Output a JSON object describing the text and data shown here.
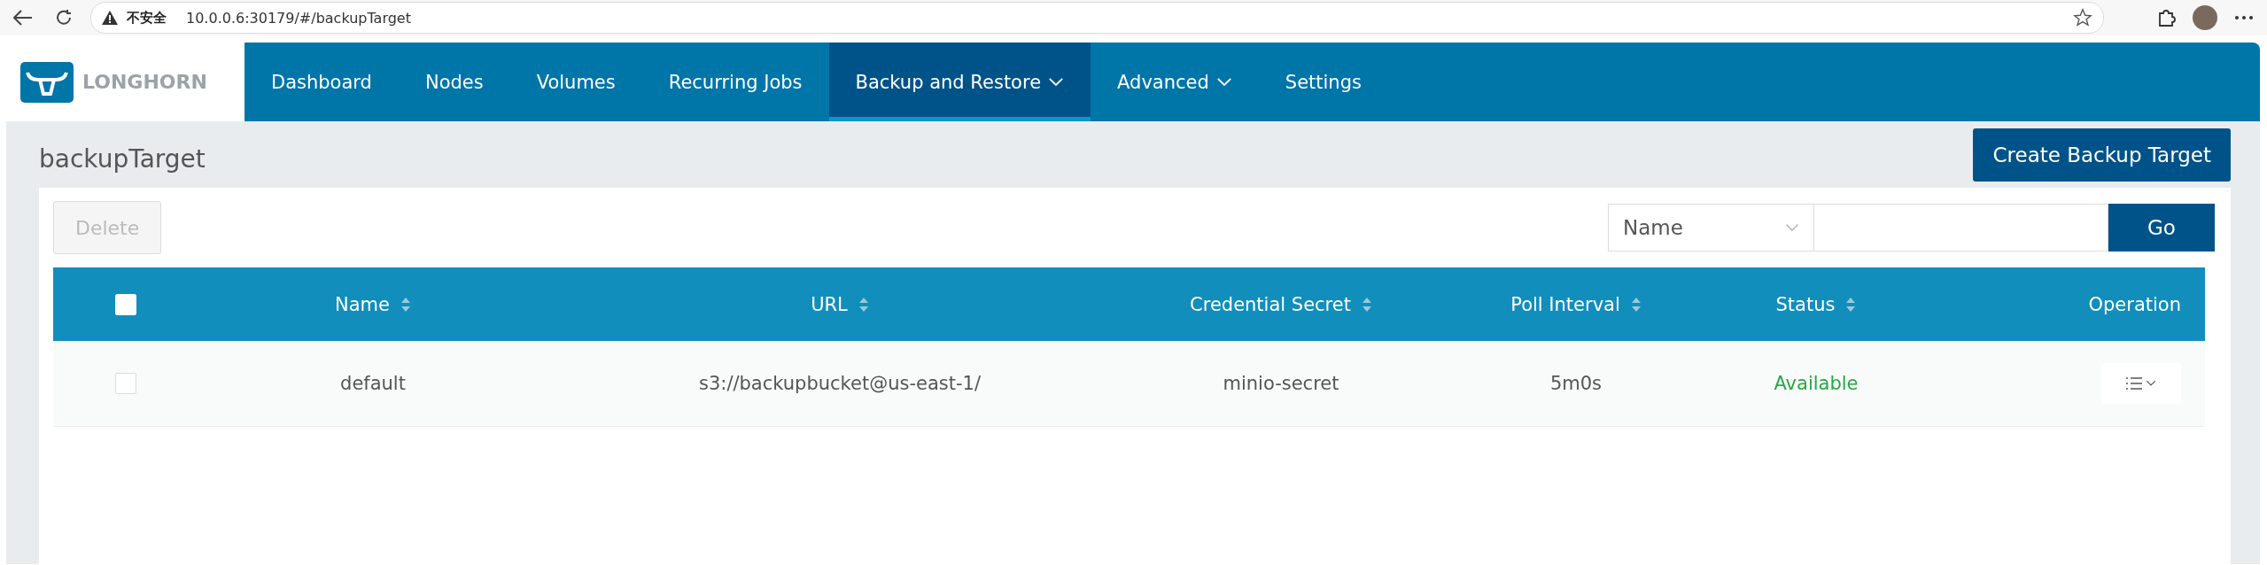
{
  "browser": {
    "security_label": "不安全",
    "url": "10.0.0.6:30179/#/backupTarget"
  },
  "nav": {
    "brand": "LONGHORN",
    "items": [
      {
        "label": "Dashboard",
        "selected": false,
        "dropdown": false
      },
      {
        "label": "Nodes",
        "selected": false,
        "dropdown": false
      },
      {
        "label": "Volumes",
        "selected": false,
        "dropdown": false
      },
      {
        "label": "Recurring Jobs",
        "selected": false,
        "dropdown": false
      },
      {
        "label": "Backup and Restore",
        "selected": true,
        "dropdown": true
      },
      {
        "label": "Advanced",
        "selected": false,
        "dropdown": true
      },
      {
        "label": "Settings",
        "selected": false,
        "dropdown": false
      }
    ]
  },
  "page": {
    "title": "backupTarget",
    "create_button": "Create Backup Target"
  },
  "toolbar": {
    "delete_button": {
      "label": "Delete",
      "disabled": true
    },
    "search": {
      "field": "Name",
      "button": "Go"
    }
  },
  "table": {
    "select_all_checked": false,
    "columns": [
      {
        "label": "Name",
        "sortable": true
      },
      {
        "label": "URL",
        "sortable": true
      },
      {
        "label": "Credential Secret",
        "sortable": true
      },
      {
        "label": "Poll Interval",
        "sortable": true
      },
      {
        "label": "Status",
        "sortable": true
      },
      {
        "label": "Operation",
        "sortable": false
      }
    ],
    "rows": [
      {
        "checked": false,
        "cells": [
          "default",
          "s3://backupbucket@us-east-1/",
          "minio-secret",
          "5m0s"
        ],
        "status": {
          "text": "Available",
          "kind": "available"
        }
      }
    ]
  }
}
